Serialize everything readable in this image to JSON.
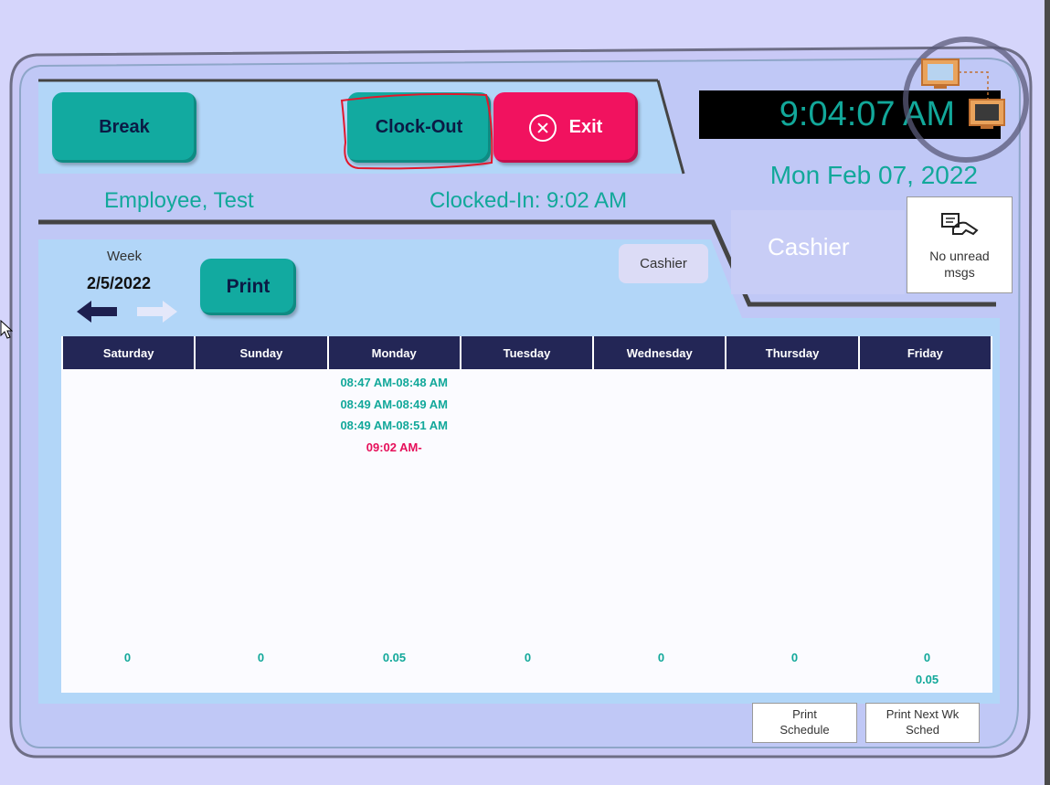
{
  "header": {
    "break_label": "Break",
    "clockout_label": "Clock-Out",
    "exit_label": "Exit",
    "clock_time": "9:04:07 AM",
    "date": "Mon Feb 07, 2022",
    "employee_name": "Employee, Test",
    "clocked_in": "Clocked-In: 9:02 AM",
    "role": "Cashier",
    "messages": "No unread msgs"
  },
  "week": {
    "label": "Week",
    "date": "2/5/2022",
    "print_label": "Print",
    "role_chip": "Cashier"
  },
  "schedule": {
    "days": [
      "Saturday",
      "Sunday",
      "Monday",
      "Tuesday",
      "Wednesday",
      "Thursday",
      "Friday"
    ],
    "monday_entries": [
      {
        "text": "08:47 AM-08:48 AM",
        "status": "closed"
      },
      {
        "text": "08:49 AM-08:49 AM",
        "status": "closed"
      },
      {
        "text": "08:49 AM-08:51 AM",
        "status": "closed"
      },
      {
        "text": "09:02 AM-",
        "status": "open"
      }
    ],
    "totals": [
      "0",
      "0",
      "0.05",
      "0",
      "0",
      "0",
      "0"
    ],
    "week_total": "0.05"
  },
  "footer": {
    "print_schedule": "Print Schedule",
    "print_next_week": "Print Next Wk Sched"
  },
  "colors": {
    "teal": "#12aaa0",
    "red": "#f1125f",
    "navy": "#232656",
    "panel": "#b2d6f8",
    "background": "#d5d5fb"
  }
}
